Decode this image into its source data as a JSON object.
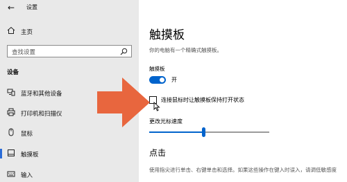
{
  "app": {
    "title": "设置"
  },
  "sidebar": {
    "home": "主页",
    "search_placeholder": "查找设置",
    "section": "设备",
    "items": [
      {
        "label": "蓝牙和其他设备",
        "icon": "bluetooth-devices-icon",
        "selected": false
      },
      {
        "label": "打印机和扫描仪",
        "icon": "printer-icon",
        "selected": false
      },
      {
        "label": "鼠标",
        "icon": "mouse-icon",
        "selected": false
      },
      {
        "label": "触摸板",
        "icon": "touchpad-icon",
        "selected": true
      },
      {
        "label": "输入",
        "icon": "keyboard-icon",
        "selected": false
      }
    ]
  },
  "main": {
    "title": "触摸板",
    "description": "你的电脑有一个精确式触摸板。",
    "toggle": {
      "label": "触摸板",
      "state": "开",
      "on": true
    },
    "checkbox": {
      "label": "连接鼠标时让触摸板保持打开状态",
      "checked": false
    },
    "speed": {
      "label": "更改光标速度",
      "value": 0.45
    },
    "tap_section": {
      "title": "点击",
      "text": "使用指尖进行单击、右键单击和选择。如果这些操作在键入时误入，请调低敏感度"
    }
  },
  "colors": {
    "accent": "#0063cc",
    "arrow": "#e8663e",
    "sidebar_bg": "#e9e9e9"
  }
}
